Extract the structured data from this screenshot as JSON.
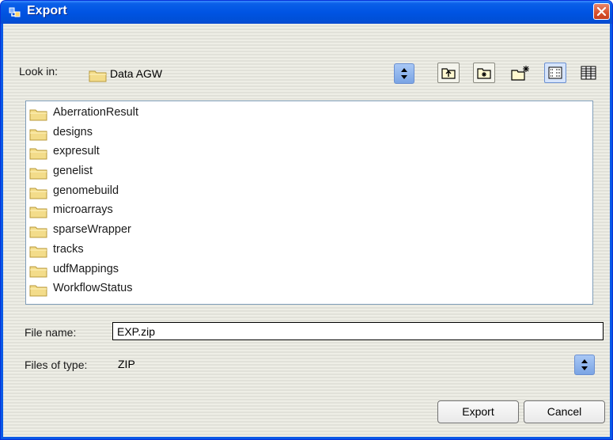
{
  "window": {
    "title": "Export"
  },
  "lookin": {
    "label": "Look in:",
    "value": "Data AGW"
  },
  "toolbar": {
    "icons": [
      "up-one-level-icon",
      "home-folder-icon",
      "new-folder-icon",
      "list-view-icon",
      "details-view-icon"
    ]
  },
  "files": [
    "AberrationResult",
    "designs",
    "expresult",
    "genelist",
    "genomebuild",
    "microarrays",
    "sparseWrapper",
    "tracks",
    "udfMappings",
    "WorkflowStatus"
  ],
  "filename": {
    "label": "File name:",
    "value": "EXP.zip"
  },
  "filetype": {
    "label": "Files of type:",
    "value": "ZIP"
  },
  "buttons": {
    "export": "Export",
    "cancel": "Cancel"
  },
  "colors": {
    "titlebar": "#0054e3",
    "close": "#d8502c",
    "folder": "#f3dc8a",
    "list_border": "#7f9db9"
  }
}
